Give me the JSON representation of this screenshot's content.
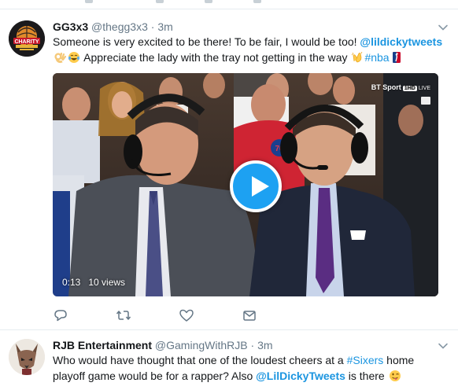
{
  "tweets": [
    {
      "display_name": "GG3x3",
      "handle": "@thegg3x3",
      "separator": "·",
      "time": "3m",
      "text_before": "Someone is very excited to be there! To be fair, I would be too! ",
      "mention": "@lildickytweets",
      "text_after": " Appreciate the lady with the tray not getting in the way ",
      "hashtag": "#nba",
      "avatar_icon": "gg3x3-charity-logo",
      "video": {
        "network": "BT Sport",
        "channel": "1HD",
        "live": "LIVE",
        "duration": "0:13",
        "views": "10 views"
      },
      "action_icons": [
        "reply-icon",
        "retweet-icon",
        "like-icon",
        "direct-message-icon"
      ]
    },
    {
      "display_name": "RJB Entertainment",
      "handle": "@GamingWithRJB",
      "separator": "·",
      "time": "3m",
      "text_before": "Who would have thought that one of the loudest cheers at a ",
      "hashtag": "#Sixers",
      "text_mid": " home playoff game would be for a rapper? Also ",
      "mention": "@LilDickyTweets",
      "text_after": " is there ",
      "avatar_icon": "rjb-fox-avatar"
    }
  ],
  "colors": {
    "link": "#1b95e0",
    "secondary_text": "#657786",
    "play_button": "#1da1f2",
    "divider": "#e6ecf0"
  }
}
